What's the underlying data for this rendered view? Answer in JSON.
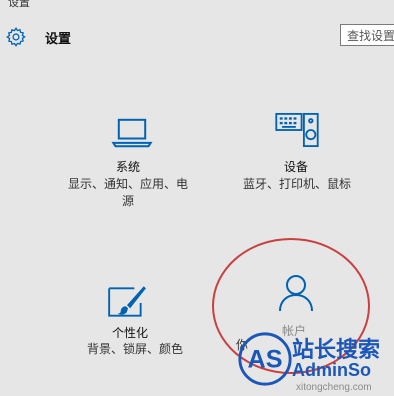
{
  "window": {
    "title": "设置"
  },
  "header": {
    "title": "设置",
    "icon": "gear-icon"
  },
  "search": {
    "placeholder": "查找设置"
  },
  "tiles": [
    {
      "id": "system",
      "icon": "laptop-icon",
      "label": "系统",
      "desc_line1": "显示、通知、应用、电",
      "desc_line2": "源"
    },
    {
      "id": "devices",
      "icon": "keyboard-speaker-icon",
      "label": "设备",
      "desc_line1": "蓝牙、打印机、鼠标",
      "desc_line2": ""
    },
    {
      "id": "personalization",
      "icon": "paintbrush-icon",
      "label": "个性化",
      "desc_line1": "背景、锁屏、颜色",
      "desc_line2": ""
    },
    {
      "id": "accounts",
      "icon": "person-icon",
      "label": "帐户",
      "desc_line1": "你",
      "desc_line2": ""
    }
  ],
  "watermark": {
    "logo_text": "AS",
    "title": "站长搜索",
    "brand_a": "Admin",
    "brand_b": "So",
    "url": "xitongcheng.com"
  },
  "colors": {
    "accent": "#0063b1",
    "highlight_circle": "#c94040",
    "watermark": "#1a57b8"
  }
}
